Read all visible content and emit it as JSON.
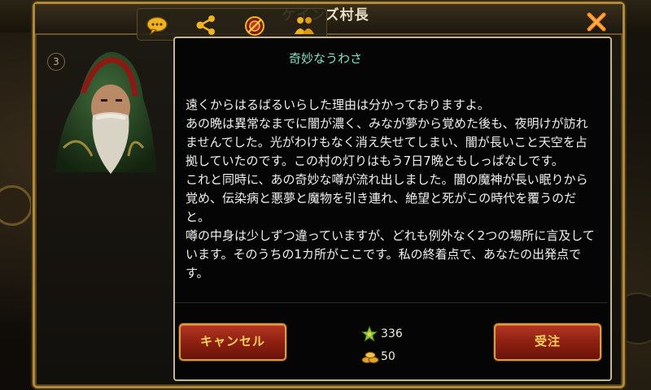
{
  "dialog": {
    "title": "ケインズ村長",
    "badge": "3"
  },
  "quest": {
    "title": "奇妙なうわさ",
    "body": "遠くからはるばるいらした理由は分かっておりますよ。\nあの晩は異常なまでに闇が濃く、みなが夢から覚めた後も、夜明けが訪れませんでした。光がわけもなく消え失せてしまい、闇が長いこと天空を占拠していたのです。この村の灯りはもう7日7晩ともしっぱなしです。\nこれと同時に、あの奇妙な噂が流れ出しました。闇の魔神が長い眠りから覚め、伝染病と悪夢と魔物を引き連れ、絶望と死がこの時代を覆うのだと。\n噂の中身は少しずつ違っていますが、どれも例外なく2つの場所に言及しています。そのうちの1カ所がここです。私の終着点で、あなたの出発点です。"
  },
  "rewards": {
    "exp_value": "336",
    "gold_value": "50"
  },
  "buttons": {
    "cancel": "キャンセル",
    "accept": "受注"
  },
  "icons": {
    "toolbar": [
      "chat-icon",
      "share-icon",
      "emblem-icon",
      "party-icon"
    ],
    "close": "close-icon",
    "exp": "exp-star-icon",
    "gold": "gold-coins-icon"
  },
  "colors": {
    "frame": "#b08a3a",
    "subtitle": "#7fe2c8",
    "button": "#9a2514",
    "button_text": "#ffd35a",
    "close": "#ff8a1c"
  }
}
